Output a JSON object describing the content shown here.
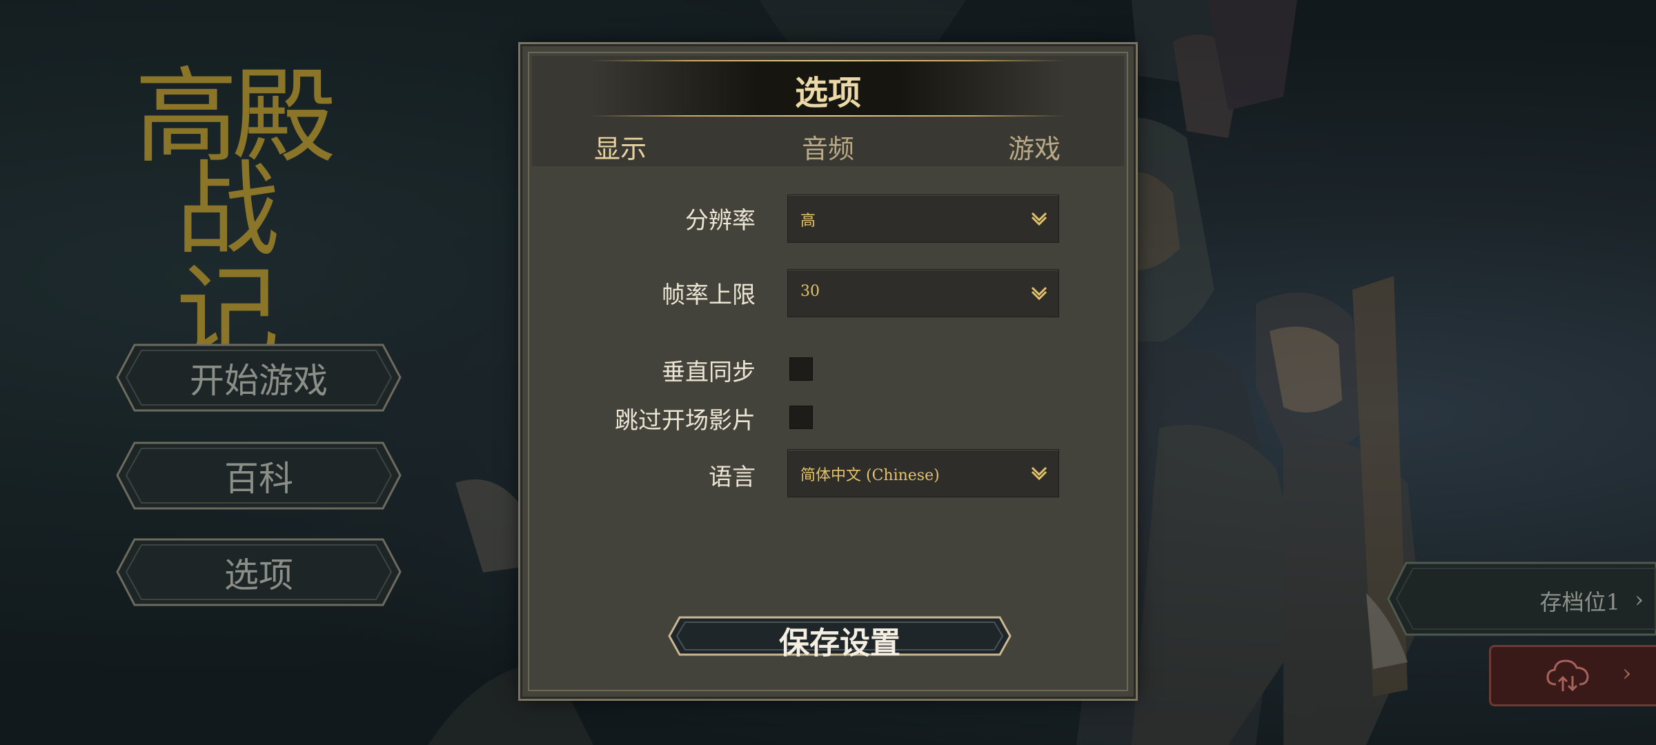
{
  "logo": {
    "line1": "高殿",
    "line2": "战记"
  },
  "main_menu": {
    "start_game": "开始游戏",
    "encyclopedia": "百科",
    "options": "选项"
  },
  "dialog": {
    "title": "选项",
    "tabs": [
      {
        "label": "显示",
        "active": true
      },
      {
        "label": "音频",
        "active": false
      },
      {
        "label": "游戏",
        "active": false
      }
    ],
    "settings": {
      "resolution": {
        "label": "分辨率",
        "value": "高"
      },
      "frame_rate_cap": {
        "label": "帧率上限",
        "value": "30"
      },
      "vsync": {
        "label": "垂直同步",
        "checked": false
      },
      "skip_intro": {
        "label": "跳过开场影片",
        "checked": false
      },
      "language": {
        "label": "语言",
        "value": "简体中文 (Chinese)"
      }
    },
    "save_button": "保存设置"
  },
  "save_slot": {
    "label": "存档位1",
    "arrow": "›"
  },
  "cloud_sync": {
    "icon": "cloud-sync-icon",
    "arrow": "›"
  },
  "colors": {
    "accent_gold": "#e2c36c",
    "dialog_bg": "#43423b",
    "cloud_button_bg": "#3a1a18"
  }
}
